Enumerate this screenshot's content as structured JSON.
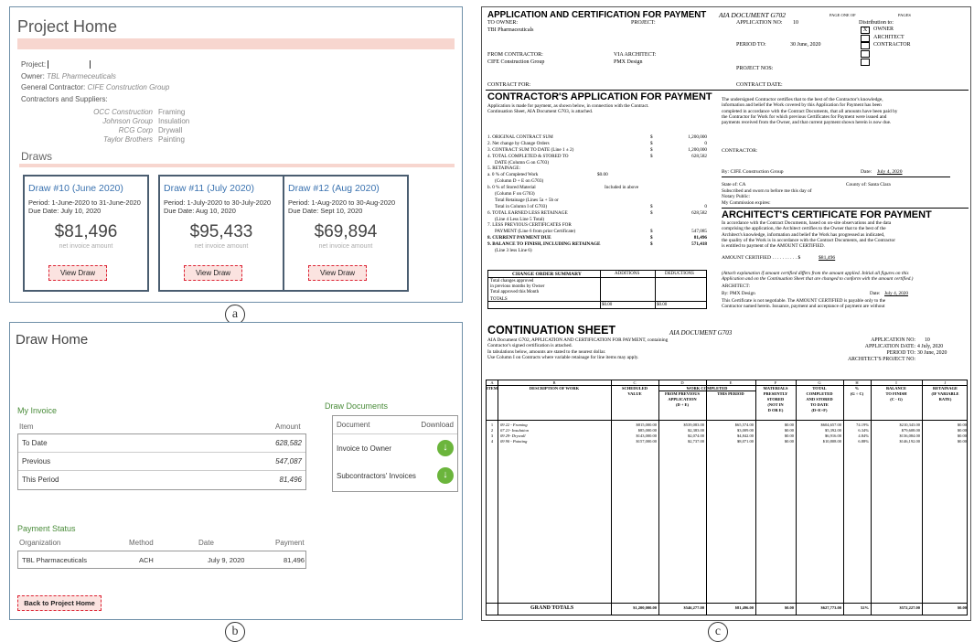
{
  "panel_a": {
    "title": "Project Home",
    "project_label": "Project:",
    "owner_label": "Owner",
    "owner": "TBL Pharmeceuticals",
    "gc_label": "General Contractor",
    "gc": "CIFE Construction Group",
    "contractors_label": "Contractors and Suppliers:",
    "contractors": [
      {
        "name": "OCC Construction",
        "trade": "Framing"
      },
      {
        "name": "Johnson Group",
        "trade": "Insulation"
      },
      {
        "name": "RCG Corp",
        "trade": "Drywall"
      },
      {
        "name": "Taylor Brothers",
        "trade": "Painting"
      }
    ],
    "draws_label": "Draws",
    "draws": [
      {
        "title": "Draw #10 (June 2020)",
        "period": "Period: 1-June-2020 to 31-June-2020",
        "due": "Due Date: July 10, 2020",
        "amount": "$81,496",
        "sub": "net invoice amount",
        "button": "View Draw"
      },
      {
        "title": "Draw #11 (July 2020)",
        "period": "Period: 1-July-2020 to 30-July-2020",
        "due": "Due Date: Aug 10, 2020",
        "amount": "$95,433",
        "sub": "net invoice amount",
        "button": "View Draw"
      },
      {
        "title": "Draw #12 (Aug 2020)",
        "period": "Period: 1-Aug-2020 to 30-Aug-2020",
        "due": "Due Date: Sept 10, 2020",
        "amount": "$69,894",
        "sub": "net invoice amount",
        "button": "View Draw"
      }
    ],
    "caption": "a"
  },
  "panel_b": {
    "title": "Draw Home",
    "my_invoice": "My Invoice",
    "item_header": "Item",
    "amount_header": "Amount",
    "rows": [
      {
        "item": "To Date",
        "amount": "628,582"
      },
      {
        "item": "Previous",
        "amount": "547,087"
      },
      {
        "item": "This Period",
        "amount": "81,496"
      }
    ],
    "draw_documents": "Draw Documents",
    "doc_header": "Document",
    "download_header": "Download",
    "docs": [
      "Invoice to Owner",
      "Subcontractors' Invoices"
    ],
    "payment_status": "Payment Status",
    "pay_headers": [
      "Organization",
      "Method",
      "Date",
      "Payment"
    ],
    "payment": {
      "org": "TBL Pharmaceuticals",
      "method": "ACH",
      "date": "July 9, 2020",
      "amount": "81,496"
    },
    "back_button": "Back to Project Home",
    "caption": "b"
  },
  "panel_c": {
    "app_title": "APPLICATION AND CERTIFICATION FOR PAYMENT",
    "aia_doc": "AIA DOCUMENT G702",
    "page_of": "PAGE ONE OF",
    "pages": "PAGES",
    "to_owner": "TO OWNER:",
    "owner": "TBI Pharmaceuticals",
    "project": "PROJECT:",
    "application_no_label": "APPLICATION NO:",
    "application_no": "10",
    "distribution": "Distribution to:",
    "dist_owner": "OWNER",
    "dist_architect": "ARCHITECT",
    "dist_contractor": "CONTRACTOR",
    "dist_mark": "X",
    "period_to_label": "PERIOD TO:",
    "period_to": "30 June, 2020",
    "from_contractor": "FROM CONTRACTOR:",
    "via_architect": "VIA ARCHITECT:",
    "contractor": "CIFE Construction Group",
    "architect": "PMX Design",
    "project_nos": "PROJECT NOS:",
    "contract_for": "CONTRACT FOR:",
    "contract_date": "CONTRACT DATE:",
    "cap_title": "CONTRACTOR'S APPLICATION FOR PAYMENT",
    "cap_text": [
      "Application is made for payment, as shown below, in connection with the Contract.",
      "Continuation Sheet, AIA Document G703, is attached."
    ],
    "lines": [
      {
        "label": "1. ORIGINAL CONTRACT SUM",
        "value": "1,200,000"
      },
      {
        "label": "2. Net change by Change Orders",
        "value": "0"
      },
      {
        "label": "3. CONTRACT SUM TO DATE (Line 1 ± 2)",
        "value": "1,200,000"
      },
      {
        "label": "4. TOTAL COMPLETED & STORED TO",
        "value": "628,582"
      },
      {
        "label": "DATE     (Column G on G703)",
        "value": ""
      },
      {
        "label": "5. RETAINAGE:",
        "value": ""
      },
      {
        "label": "a.     0  % of Completed Work",
        "value": "$0.00"
      },
      {
        "label": "(Column D + E on G703)",
        "value": ""
      },
      {
        "label": "b.     0  % of Stored Material",
        "value": "Included in above"
      },
      {
        "label": "(Column F on G703)",
        "value": ""
      },
      {
        "label": "Total Retainage (Lines 5a + 5b or",
        "value": ""
      },
      {
        "label": "Total in Column I of G703)",
        "value": "0"
      },
      {
        "label": "6. TOTAL EARNED LESS RETAINAGE",
        "value": "628,582"
      },
      {
        "label": "(Line 4 Less Line 5 Total)",
        "value": ""
      },
      {
        "label": "7. LESS PREVIOUS CERTIFICATES FOR",
        "value": ""
      },
      {
        "label": "PAYMENT (Line 6 from prior Certificate)",
        "value": "547,085"
      },
      {
        "label": "8. CURRENT PAYMENT DUE",
        "value": "81,496"
      },
      {
        "label": "9. BALANCE TO FINISH, INCLUDING RETAINAGE",
        "value": "571,418"
      },
      {
        "label": "(Line 3 less Line 6)",
        "value": ""
      }
    ],
    "co_summary": {
      "headers": [
        "CHANGE ORDER SUMMARY",
        "ADDITIONS",
        "DEDUCTIONS"
      ],
      "rows": [
        "Total changes approved",
        "in previous months by Owner",
        "Total approved this Month",
        "TOTALS"
      ],
      "totals": [
        "$0.00",
        "$0.00"
      ]
    },
    "cert_text": [
      "The undersigned Contractor certifies that to the best of the Contractor's knowledge,",
      "information and belief the Work covered by this Application for Payment has been",
      "completed in accordance with the Contract Documents, that all amounts have been paid by",
      "the Contractor for Work for which previous Certificates for Payment were issued and",
      "payments received from the Owner, and that current payment shown herein is now due."
    ],
    "contractor_label": "CONTRACTOR:",
    "by_label": "By: CIFE Construction Group",
    "date_label": "Date:",
    "by_date": "July 4, 2020",
    "state": "State of:             CA",
    "county": "County of:  Santa Clara",
    "notary": [
      "Subscribed and sworn to before me this         day of",
      "Notary Public:",
      "My Commission expires:"
    ],
    "arch_cert_title": "ARCHITECT'S CERTIFICATE FOR PAYMENT",
    "arch_text": [
      "In accordance with the Contract Documents, based on on-site observations and the data",
      "comprising the application, the Architect certifies to the Owner that to the best of  the",
      "Architect's knowledge, information and belief the Work has progressed as indicated,",
      "the quality of the Work is in accordance with the Contract Documents, and the Contractor",
      "is entitled to payment of the AMOUNT CERTIFIED."
    ],
    "amount_certified_label": "AMOUNT CERTIFIED . . . . . . . . . .  $",
    "amount_certified": "$81,496",
    "attach_text": [
      "(Attach explanation if amount certified differs from the amount applied. Initial all figures on this",
      "Application and on the Continuation Sheet that are changed to conform with the amount certified.)"
    ],
    "architect_label": "ARCHITECT:",
    "arch_by": "By:  PMX Design",
    "arch_date": "July 4, 2020",
    "negotiable": "This Certificate is not negotiable.  The AMOUNT CERTIFIED is payable only to the",
    "negotiable2": "Contractor named herein. Issuance, payment and acceptance of payment are without",
    "cs_title": "CONTINUATION SHEET",
    "cs_aia": "AIA DOCUMENT G703",
    "cs_text": [
      "AIA Document G702, APPLICATION AND CERTIFICATION FOR PAYMENT, containing",
      "Contractor's signed certification is attached.",
      "In tabulations below, amounts are stated to the nearest dollar.",
      "Use Column I on Contracts where variable retainage for line items may apply."
    ],
    "cs_app_no_label": "APPLICATION NO:",
    "cs_app_no": "10",
    "cs_app_date_label": "APPLICATION DATE:",
    "cs_app_date": "4 July, 2020",
    "cs_period_label": "PERIOD TO:",
    "cs_period": "30 June, 2020",
    "cs_arch_proj": "ARCHITECT'S PROJECT NO:",
    "cs_letters": [
      "A",
      "B",
      "C",
      "D",
      "E",
      "F",
      "G",
      "H",
      "I",
      "J"
    ],
    "cs_headers": [
      "ITEM",
      "DESCRIPTION OF WORK",
      "SCHEDULED\nVALUE",
      "FROM PREVIOUS\nAPPLICATION\n(D + E)",
      "THIS PERIOD",
      "MATERIALS\nPRESENTLY\nSTORED\n(NOT IN\nD OR E)",
      "TOTAL\nCOMPLETED\nAND STORED\nTO DATE\n(D+E+F)",
      "%\n(G ÷ C)",
      "BALANCE\nTO FINISH\n(C - G)",
      "RETAINAGE\n(IF VARIABLE\nRATE)"
    ],
    "work_completed": "WORK COMPLETED",
    "cs_rows": [
      [
        "1",
        "09 22 - Framing",
        "$815,000.00",
        "$539,083.00",
        "$65,574.00",
        "$0.00",
        "$604,657.00",
        "74.19%",
        "$210,343.00",
        "$0.00"
      ],
      [
        "2",
        "07 21- Insulation",
        "$85,000.00",
        "$2,383.00",
        "$3,009.00",
        "$0.00",
        "$5,392.00",
        "6.34%",
        "$79,608.00",
        "$0.00"
      ],
      [
        "3",
        "09 29- Drywall",
        "$143,000.00",
        "$2,074.00",
        "$4,842.00",
        "$0.00",
        "$6,916.00",
        "4.84%",
        "$136,084.00",
        "$0.00"
      ],
      [
        "4",
        "09 90 - Painting",
        "$157,000.00",
        "$2,737.00",
        "$8,071.00",
        "$0.00",
        "$10,808.00",
        "6.88%",
        "$146,192.00",
        "$0.00"
      ]
    ],
    "cs_total": [
      "GRAND TOTALS",
      "$1,200,000.00",
      "$546,277.00",
      "$81,496.00",
      "$0.00",
      "$627,773.00",
      "52%",
      "$572,227.00",
      "$0.00"
    ],
    "caption": "c"
  }
}
